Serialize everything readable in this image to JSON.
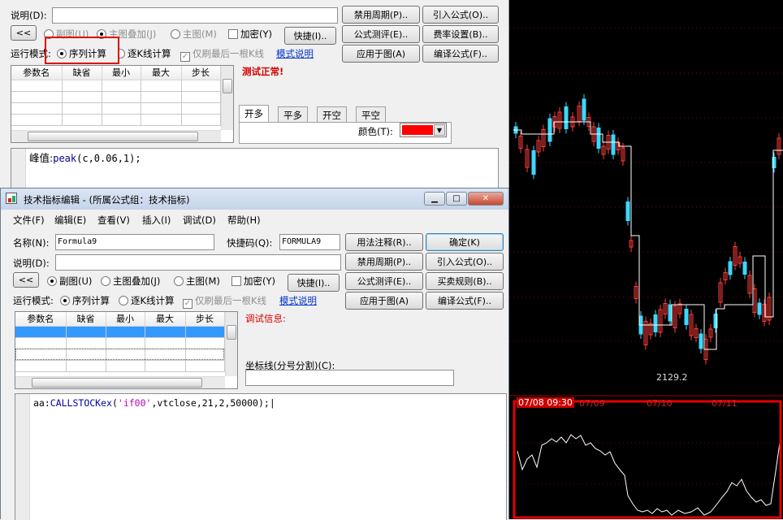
{
  "back_dialog": {
    "desc_label": "说明(D):",
    "desc_value": "",
    "back_button": "<<",
    "sub_chart_label": "副图(U)",
    "main_overlay_label": "主图叠加(J)",
    "main_chart_label": "主图(M)",
    "encrypt_label": "加密(Y)",
    "run_mode_label": "运行模式:",
    "sequence_calc_label": "序列计算",
    "kline_calc_label": "逐K线计算",
    "refresh_last_label": "仅刷最后一根K线",
    "mode_help_link": "模式说明",
    "status_text": "测试正常!",
    "grid_headers": [
      "参数名",
      "缺省",
      "最小",
      "最大",
      "步长"
    ],
    "buttons": {
      "disable_period": "禁用周期(P)..",
      "import_formula": "引入公式(O)..",
      "shortcut": "快捷(I)..",
      "formula_test": "公式测评(E)..",
      "fee_settings": "费率设置(B)..",
      "apply_to_chart": "应用于图(A)",
      "compile_formula": "编译公式(F).."
    },
    "tabs": [
      "开多",
      "平多",
      "开空",
      "平空"
    ],
    "color_label": "颜色(T):",
    "color_value": "#ff0000",
    "code_prefix": "峰值:",
    "code_func": "peak",
    "code_args": "(c,0.06,1);"
  },
  "dialog": {
    "title": "技术指标编辑 - (所属公式组：技术指标)",
    "menus": [
      "文件(F)",
      "编辑(E)",
      "查看(V)",
      "插入(I)",
      "调试(D)",
      "帮助(H)"
    ],
    "name_label": "名称(N):",
    "name_value": "Formula9",
    "shortcut_code_label": "快捷码(Q):",
    "shortcut_code_value": "FORMULA9",
    "desc_label": "说明(D):",
    "desc_value": "",
    "back_button": "<<",
    "sub_chart_label": "副图(U)",
    "main_overlay_label": "主图叠加(J)",
    "main_chart_label": "主图(M)",
    "encrypt_label": "加密(Y)",
    "run_mode_label": "运行模式:",
    "sequence_calc_label": "序列计算",
    "kline_calc_label": "逐K线计算",
    "refresh_last_label": "仅刷最后一根K线",
    "mode_help_link": "模式说明",
    "debug_info_label": "调试信息:",
    "axis_lines_label": "坐标线(分号分割)(C):",
    "axis_lines_value": "",
    "grid_headers": [
      "参数名",
      "缺省",
      "最小",
      "最大",
      "步长"
    ],
    "buttons": {
      "usage_note": "用法注释(R)..",
      "confirm": "确定(K)",
      "disable_period": "禁用周期(P)..",
      "import_formula": "引入公式(O)..",
      "shortcut": "快捷(I)..",
      "formula_test": "公式测评(E)..",
      "trade_rules": "买卖规则(B)..",
      "apply_to_chart": "应用于图(A)",
      "compile_formula": "编译公式(F).."
    },
    "code_prefix": "aa:",
    "code_func": "CALLSTOCKex",
    "code_open": "(",
    "code_string": "'if00'",
    "code_rest": ",vtclose,21,2,50000);"
  },
  "chart": {
    "low_label": "2129.2",
    "time_labels": [
      "07/08 09:30",
      "07/09",
      "07/10",
      "07/11"
    ],
    "colors": {
      "up": "#ff3c3c",
      "down": "#3cd8ff",
      "line": "#ffffff",
      "highlight": "#e60000"
    }
  }
}
